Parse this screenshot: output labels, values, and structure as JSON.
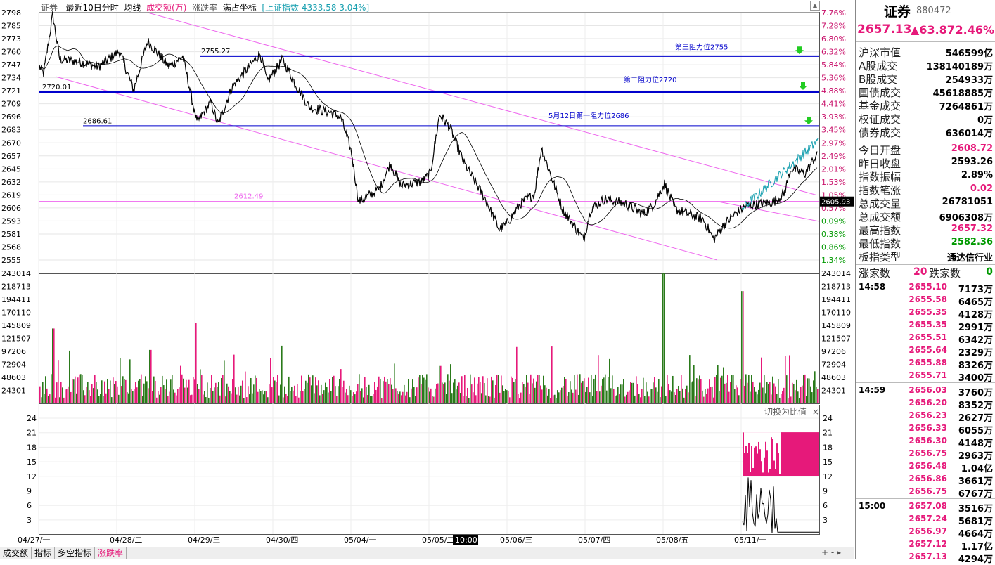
{
  "toolbar": {
    "name": "证券",
    "period": "最近10日分时",
    "mode": "均线",
    "indicator": "成交额(万)",
    "change_rate": "涨跌率",
    "full_coord": "满占坐标",
    "ref_index": "[上证指数",
    "ref_value": "4333.58 3.04%]"
  },
  "chart_data": {
    "type": "line",
    "title": "证券 最近10日分时",
    "price_axis_left": [
      2798,
      2785,
      2773,
      2760,
      2747,
      2734,
      2721,
      2709,
      2696,
      2683,
      2670,
      2657,
      2645,
      2632,
      2619,
      2606,
      2593,
      2581,
      2568,
      2555
    ],
    "pct_axis_right": [
      "7.76%",
      "7.28%",
      "6.80%",
      "6.32%",
      "5.84%",
      "5.36%",
      "4.88%",
      "4.41%",
      "3.93%",
      "3.45%",
      "2.97%",
      "2.49%",
      "2.01%",
      "1.53%",
      "1.05%",
      "0.57%",
      "0.09%",
      "0.38%",
      "0.86%",
      "1.34%"
    ],
    "volume_axis": [
      243014,
      218713,
      194411,
      170110,
      145809,
      121507,
      97206,
      72904,
      48603,
      24301
    ],
    "ratio_axis": [
      24,
      21,
      18,
      15,
      12,
      9,
      6,
      3
    ],
    "x_dates": [
      "04/27/一",
      "04/28/二",
      "04/29/三",
      "04/30/四",
      "05/04/一",
      "05/05/二",
      "05/06/三",
      "05/07/四",
      "05/08/五",
      "05/11/一"
    ],
    "cursor_time": "10:00",
    "current_price_tag": "2605.93",
    "ylim": [
      2550,
      2800
    ],
    "annotations": [
      {
        "label": "2755.27",
        "value": 2755.27
      },
      {
        "label": "2720.01",
        "value": 2720.01
      },
      {
        "label": "2686.61",
        "value": 2686.61
      },
      {
        "label": "2612.49",
        "value": 2612.49
      },
      {
        "label": "第三阻力位2755",
        "value": 2755
      },
      {
        "label": "第二阻力位2720",
        "value": 2720
      },
      {
        "label": "5月12日第一阻力位2686",
        "value": 2686
      }
    ],
    "ratio_panel_button": "切换为比值"
  },
  "bottom_tabs": [
    "成交额",
    "指标",
    "多空指标",
    "涨跌率"
  ],
  "right_panel": {
    "title": "证券",
    "code": "880472",
    "price": "2657.13",
    "change": "▲63.87",
    "change_pct": "2.46%",
    "stats": [
      {
        "label": "沪深市值",
        "value": "546599亿"
      },
      {
        "label": "A股成交",
        "value": "138140189万"
      },
      {
        "label": "B股成交",
        "value": "254933万"
      },
      {
        "label": "国债成交",
        "value": "45618885万"
      },
      {
        "label": "基金成交",
        "value": "7264861万"
      },
      {
        "label": "权证成交",
        "value": "0万"
      },
      {
        "label": "债券成交",
        "value": "636014万"
      }
    ],
    "stats2": [
      {
        "label": "今日开盘",
        "value": "2608.72"
      },
      {
        "label": "昨日收盘",
        "value": "2593.26"
      },
      {
        "label": "指数振幅",
        "value": "2.89%"
      },
      {
        "label": "指数笔涨",
        "value": "0.02"
      },
      {
        "label": "总成交量",
        "value": "26781051"
      },
      {
        "label": "总成交额",
        "value": "6906308万"
      },
      {
        "label": "最高指数",
        "value": "2657.32"
      },
      {
        "label": "最低指数",
        "value": "2582.36"
      },
      {
        "label": "板指类型",
        "value": "通达信行业"
      }
    ],
    "up_label": "涨家数",
    "up_count": "20",
    "down_label": "跌家数",
    "down_count": "0",
    "ticks": [
      {
        "time": "14:58",
        "price": "2655.10",
        "vol": "7173万"
      },
      {
        "time": "",
        "price": "2655.58",
        "vol": "6465万"
      },
      {
        "time": "",
        "price": "2655.35",
        "vol": "4128万"
      },
      {
        "time": "",
        "price": "2655.35",
        "vol": "2991万"
      },
      {
        "time": "",
        "price": "2655.51",
        "vol": "6342万"
      },
      {
        "time": "",
        "price": "2655.64",
        "vol": "2329万"
      },
      {
        "time": "",
        "price": "2655.88",
        "vol": "8326万"
      },
      {
        "time": "",
        "price": "2655.71",
        "vol": "3400万"
      },
      {
        "time": "14:59",
        "price": "2656.03",
        "vol": "3760万"
      },
      {
        "time": "",
        "price": "2656.20",
        "vol": "8352万"
      },
      {
        "time": "",
        "price": "2656.23",
        "vol": "2627万"
      },
      {
        "time": "",
        "price": "2656.33",
        "vol": "6055万"
      },
      {
        "time": "",
        "price": "2656.30",
        "vol": "4148万"
      },
      {
        "time": "",
        "price": "2656.75",
        "vol": "2963万"
      },
      {
        "time": "",
        "price": "2656.48",
        "vol": "1.04亿"
      },
      {
        "time": "",
        "price": "2656.86",
        "vol": "3661万"
      },
      {
        "time": "",
        "price": "2656.75",
        "vol": "6767万"
      },
      {
        "time": "15:00",
        "price": "2657.08",
        "vol": "3516万"
      },
      {
        "time": "",
        "price": "2657.24",
        "vol": "5681万"
      },
      {
        "time": "",
        "price": "2656.97",
        "vol": "4664万"
      },
      {
        "time": "",
        "price": "2657.12",
        "vol": "1.17亿"
      },
      {
        "time": "",
        "price": "2657.13",
        "vol": "4294万"
      }
    ]
  },
  "colors": {
    "up": "#e6197a",
    "down": "#007a00",
    "resistance": "#0000cc",
    "channel": "#ee66ee",
    "ref_line": "#19a0b0"
  }
}
